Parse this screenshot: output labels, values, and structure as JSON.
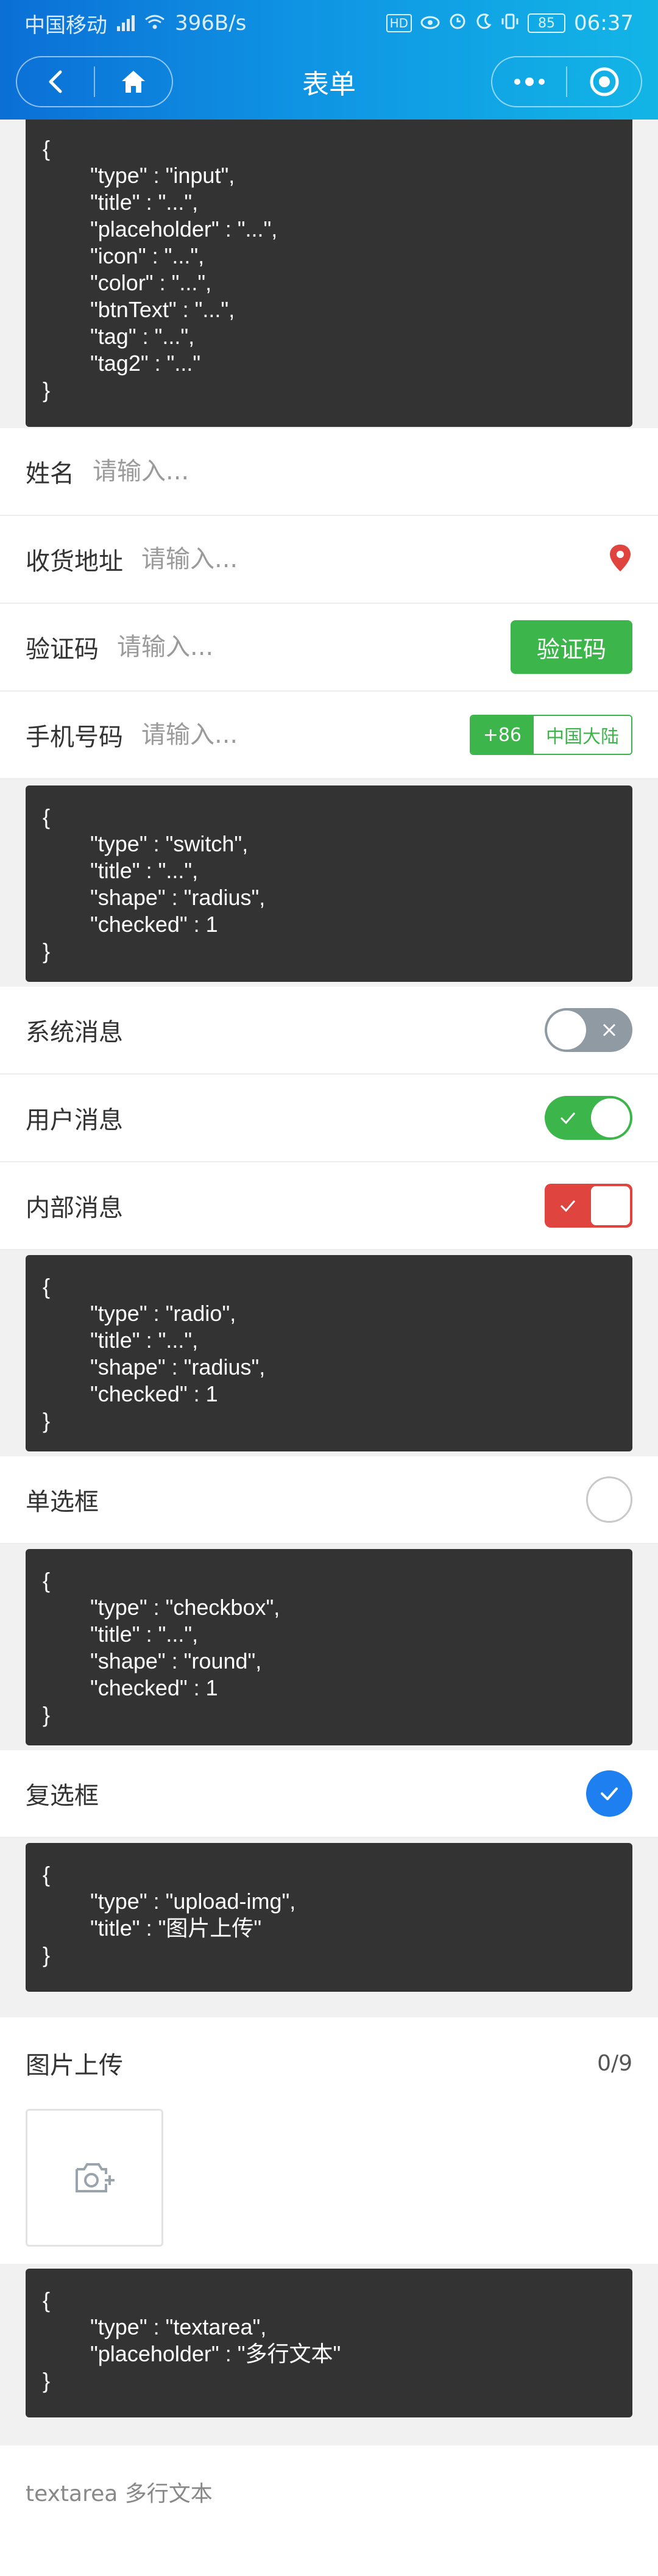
{
  "status": {
    "carrier": "中国移动",
    "net_speed": "396B/s",
    "battery": "85",
    "time": "06:37"
  },
  "nav": {
    "title": "表单"
  },
  "code_blocks": {
    "input": [
      "{",
      "\"type\" : \"input\",",
      "\"title\" : \"...\",",
      "\"placeholder\" : \"...\",",
      "\"icon\" : \"...\",",
      "\"color\" : \"...\",",
      "\"btnText\" : \"...\",",
      "\"tag\" : \"...\",",
      "\"tag2\" : \"...\"",
      "}"
    ],
    "switch": [
      "{",
      "\"type\" : \"switch\",",
      "\"title\" : \"...\",",
      "\"shape\" : \"radius\",",
      "\"checked\" : 1",
      "}"
    ],
    "radio": [
      "{",
      "\"type\" : \"radio\",",
      "\"title\" : \"...\",",
      "\"shape\" : \"radius\",",
      "\"checked\" : 1",
      "}"
    ],
    "checkbox": [
      "{",
      "\"type\" : \"checkbox\",",
      "\"title\" : \"...\",",
      "\"shape\" : \"round\",",
      "\"checked\" : 1",
      "}"
    ],
    "upload": [
      "{",
      "\"type\" : \"upload-img\",",
      "\"title\" : \"图片上传\"",
      "}"
    ],
    "textarea": [
      "{",
      "\"type\" : \"textarea\",",
      "\"placeholder\" : \"多行文本\"",
      "}"
    ]
  },
  "form": {
    "name": {
      "label": "姓名",
      "placeholder": "请输入...",
      "value": ""
    },
    "address": {
      "label": "收货地址",
      "placeholder": "请输入...",
      "value": "",
      "icon": "location-pin-icon",
      "icon_color": "#e0443e"
    },
    "code": {
      "label": "验证码",
      "placeholder": "请输入...",
      "value": "",
      "button": "验证码"
    },
    "phone": {
      "label": "手机号码",
      "placeholder": "请输入...",
      "value": "",
      "tag": "+86",
      "tag2": "中国大陆"
    }
  },
  "switches": [
    {
      "label": "系统消息",
      "checked": false
    },
    {
      "label": "用户消息",
      "checked": true
    },
    {
      "label": "内部消息",
      "checked": true
    }
  ],
  "radio": {
    "label": "单选框",
    "checked": false
  },
  "checkbox": {
    "label": "复选框",
    "checked": true
  },
  "upload": {
    "title": "图片上传",
    "count": "0/9"
  },
  "textarea": {
    "placeholder": "textarea 多行文本",
    "value": ""
  },
  "colors": {
    "green": "#3cb54a",
    "red": "#e0443e",
    "blue": "#1e7ff0",
    "header_start": "#0b6fd6",
    "header_end": "#12b5e6"
  }
}
